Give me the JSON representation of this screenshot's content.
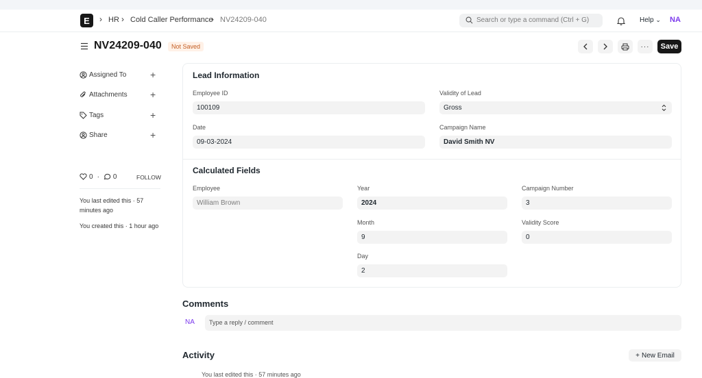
{
  "navbar": {
    "logo_letter": "E",
    "breadcrumbs": [
      "HR",
      "Cold Caller Performance",
      "NV24209-040"
    ],
    "search_placeholder": "Search or type a command (Ctrl + G)",
    "help_label": "Help",
    "user_initials": "NA"
  },
  "page": {
    "title": "NV24209-040",
    "status_badge": "Not Saved",
    "save_label": "Save"
  },
  "sidebar": {
    "items": [
      {
        "label": "Assigned To"
      },
      {
        "label": "Attachments"
      },
      {
        "label": "Tags"
      },
      {
        "label": "Share"
      }
    ],
    "likes": "0",
    "comments_count": "0",
    "follow_label": "FOLLOW",
    "last_edited": "You last edited this · 57 minutes ago",
    "created": "You created this · 1 hour ago"
  },
  "lead_info": {
    "title": "Lead Information",
    "employee_id_label": "Employee ID",
    "employee_id": "100109",
    "validity_label": "Validity of Lead",
    "validity": "Gross",
    "date_label": "Date",
    "date": "09-03-2024",
    "campaign_name_label": "Campaign Name",
    "campaign_name": "David Smith NV"
  },
  "calculated": {
    "title": "Calculated Fields",
    "employee_label": "Employee",
    "employee": "William Brown",
    "year_label": "Year",
    "year": "2024",
    "campaign_number_label": "Campaign Number",
    "campaign_number": "3",
    "month_label": "Month",
    "month": "9",
    "validity_score_label": "Validity Score",
    "validity_score": "0",
    "day_label": "Day",
    "day": "2"
  },
  "comments": {
    "title": "Comments",
    "avatar": "NA",
    "placeholder": "Type a reply / comment"
  },
  "activity": {
    "title": "Activity",
    "new_email_label": "New Email",
    "first_entry": "You last edited this · 57 minutes ago"
  }
}
